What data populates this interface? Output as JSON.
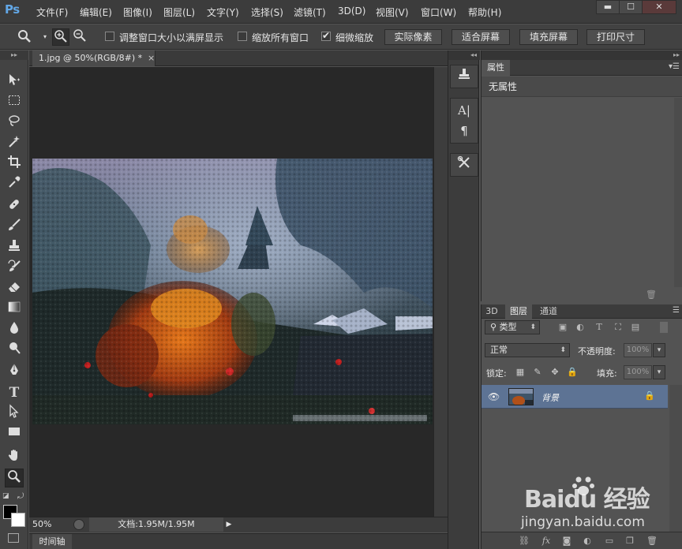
{
  "app": {
    "logo": "Ps"
  },
  "menu": [
    "文件(F)",
    "编辑(E)",
    "图像(I)",
    "图层(L)",
    "文字(Y)",
    "选择(S)",
    "滤镜(T)",
    "3D(D)",
    "视图(V)",
    "窗口(W)",
    "帮助(H)"
  ],
  "window_controls": {
    "minimize": "▬",
    "maximize": "☐",
    "close": "✕"
  },
  "options": {
    "resize_windows_label": "调整窗口大小以满屏显示",
    "resize_windows_checked": false,
    "zoom_all_label": "缩放所有窗口",
    "zoom_all_checked": false,
    "scrubby_zoom_label": "细微缩放",
    "scrubby_zoom_checked": true,
    "buttons": [
      "实际像素",
      "适合屏幕",
      "填充屏幕",
      "打印尺寸"
    ]
  },
  "document": {
    "tab_title": "1.jpg @ 50%(RGB/8#) *",
    "zoom": "50%",
    "doc_info": "文档:1.95M/1.95M"
  },
  "timeline": {
    "label": "时间轴"
  },
  "properties": {
    "tab": "属性",
    "header": "无属性"
  },
  "layers": {
    "tabs": [
      "3D",
      "图层",
      "通道"
    ],
    "filter_kind": "类型",
    "blend_mode": "正常",
    "opacity_label": "不透明度:",
    "opacity_value": "100%",
    "lock_label": "锁定:",
    "fill_label": "填充:",
    "fill_value": "100%",
    "layer_name": "背景"
  },
  "watermark": {
    "brand": "Baidu 经验",
    "url": "jingyan.baidu.com"
  },
  "colors": {
    "foreground": "#000000",
    "background": "#ffffff",
    "selected_layer": "#5d7394"
  }
}
